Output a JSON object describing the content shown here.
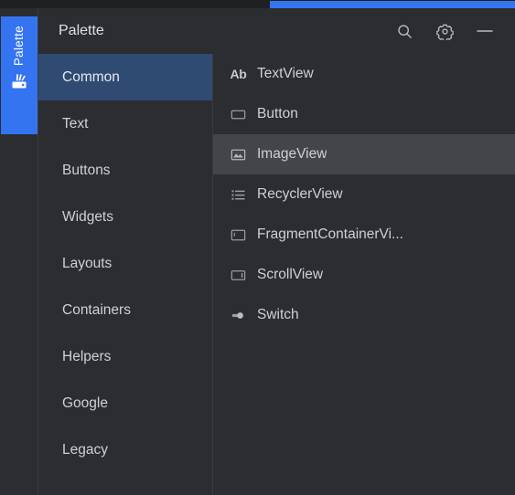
{
  "window": {
    "accent_color": "#3574f0",
    "background_color": "#2b2d30",
    "selected_category_color": "#2f4b72",
    "selected_component_color": "#43454a"
  },
  "tool_tab": {
    "label": "Palette",
    "icon": "palette-icon"
  },
  "header": {
    "title": "Palette",
    "actions": [
      {
        "name": "search-icon",
        "label": "Search"
      },
      {
        "name": "gear-icon",
        "label": "Settings"
      },
      {
        "name": "minimize-icon",
        "label": "Minimize"
      }
    ]
  },
  "categories": {
    "selected": "Common",
    "items": [
      {
        "label": "Common",
        "selected": true
      },
      {
        "label": "Text",
        "selected": false
      },
      {
        "label": "Buttons",
        "selected": false
      },
      {
        "label": "Widgets",
        "selected": false
      },
      {
        "label": "Layouts",
        "selected": false
      },
      {
        "label": "Containers",
        "selected": false
      },
      {
        "label": "Helpers",
        "selected": false
      },
      {
        "label": "Google",
        "selected": false
      },
      {
        "label": "Legacy",
        "selected": false
      }
    ]
  },
  "components": {
    "selected": "ImageView",
    "items": [
      {
        "label": "TextView",
        "icon": "textview-icon",
        "selected": false
      },
      {
        "label": "Button",
        "icon": "button-icon",
        "selected": false
      },
      {
        "label": "ImageView",
        "icon": "imageview-icon",
        "selected": true
      },
      {
        "label": "RecyclerView",
        "icon": "recyclerview-icon",
        "selected": false
      },
      {
        "label": "FragmentContainerVi...",
        "icon": "fragmentcontainerview-icon",
        "selected": false
      },
      {
        "label": "ScrollView",
        "icon": "scrollview-icon",
        "selected": false
      },
      {
        "label": "Switch",
        "icon": "switch-icon",
        "selected": false
      }
    ]
  }
}
